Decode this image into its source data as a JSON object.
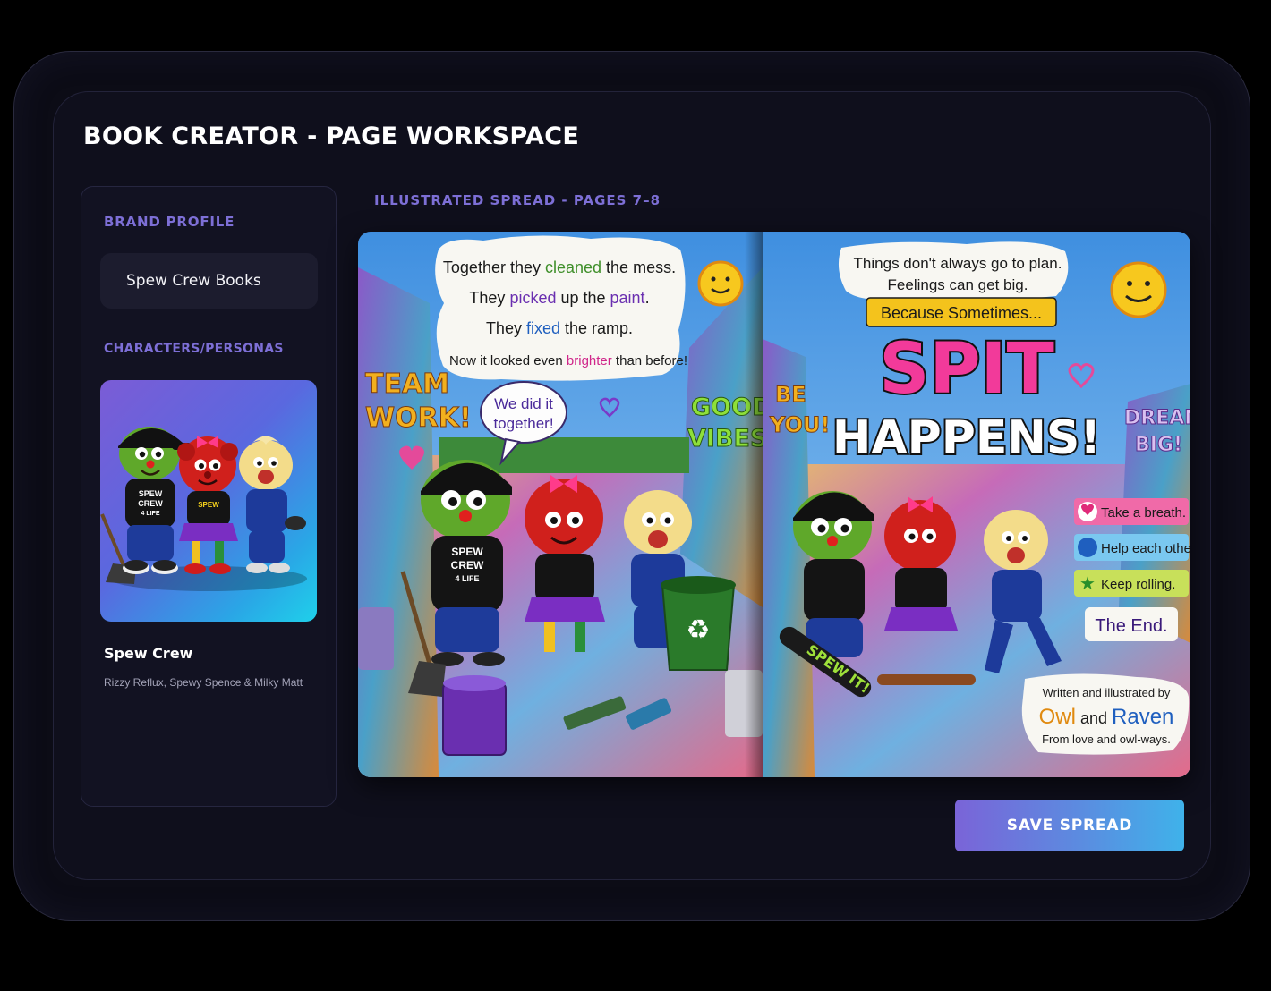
{
  "header": {
    "title": "BOOK CREATOR - PAGE WORKSPACE"
  },
  "sidebar": {
    "brand_profile_label": "BRAND PROFILE",
    "brand_name": "Spew Crew Books",
    "characters_label": "CHARACTERS/PERSONAS",
    "character": {
      "name": "Spew Crew",
      "members": "Rizzy Reflux, Spewy Spence & Milky Matt",
      "shirt_text": [
        "SPEW",
        "CREW",
        "4 LIFE"
      ]
    }
  },
  "spread": {
    "label": "ILLUSTRATED SPREAD - PAGES 7–8",
    "left_page": {
      "lines": [
        [
          "Together they ",
          "cleaned",
          " the mess."
        ],
        [
          "They ",
          "picked",
          " up the ",
          "paint",
          "."
        ],
        [
          "They ",
          "fixed",
          " the ramp."
        ],
        [
          "Now it looked even ",
          "brighter",
          " than before!"
        ]
      ],
      "speech": [
        "We did it",
        "together!"
      ],
      "graffiti_left": [
        "TEAM",
        "WORK!"
      ],
      "graffiti_right": [
        "GOOD",
        "VIBES!"
      ],
      "shirt_text": [
        "SPEW",
        "CREW",
        "4 LIFE"
      ]
    },
    "right_page": {
      "intro": [
        "Things don't always go to plan.",
        "Feelings can get big."
      ],
      "banner": "Because Sometimes...",
      "headline_1": "SPIT",
      "headline_2": "HAPPENS!",
      "graffiti_left": [
        "BE",
        "YOU!"
      ],
      "graffiti_right": [
        "DREAM",
        "BIG!"
      ],
      "skateboard_text": "SPEW IT!",
      "tips": [
        "Take a breath.",
        "Help each other.",
        "Keep rolling."
      ],
      "the_end": "The End.",
      "credits_line1": "Written and illustrated by",
      "credits_owl": "Owl",
      "credits_and": "and",
      "credits_raven": "Raven",
      "credits_line3": "From love and owl-ways."
    }
  },
  "actions": {
    "save_label": "SAVE SPREAD"
  },
  "colors": {
    "accent": "#7d6fd6",
    "button_start": "#7a64d8",
    "button_end": "#3fb2ea",
    "highlight_green": "#3f8f2a",
    "highlight_purple": "#6a2fb0",
    "highlight_blue": "#1f5fbf",
    "highlight_pink": "#d0268a"
  }
}
